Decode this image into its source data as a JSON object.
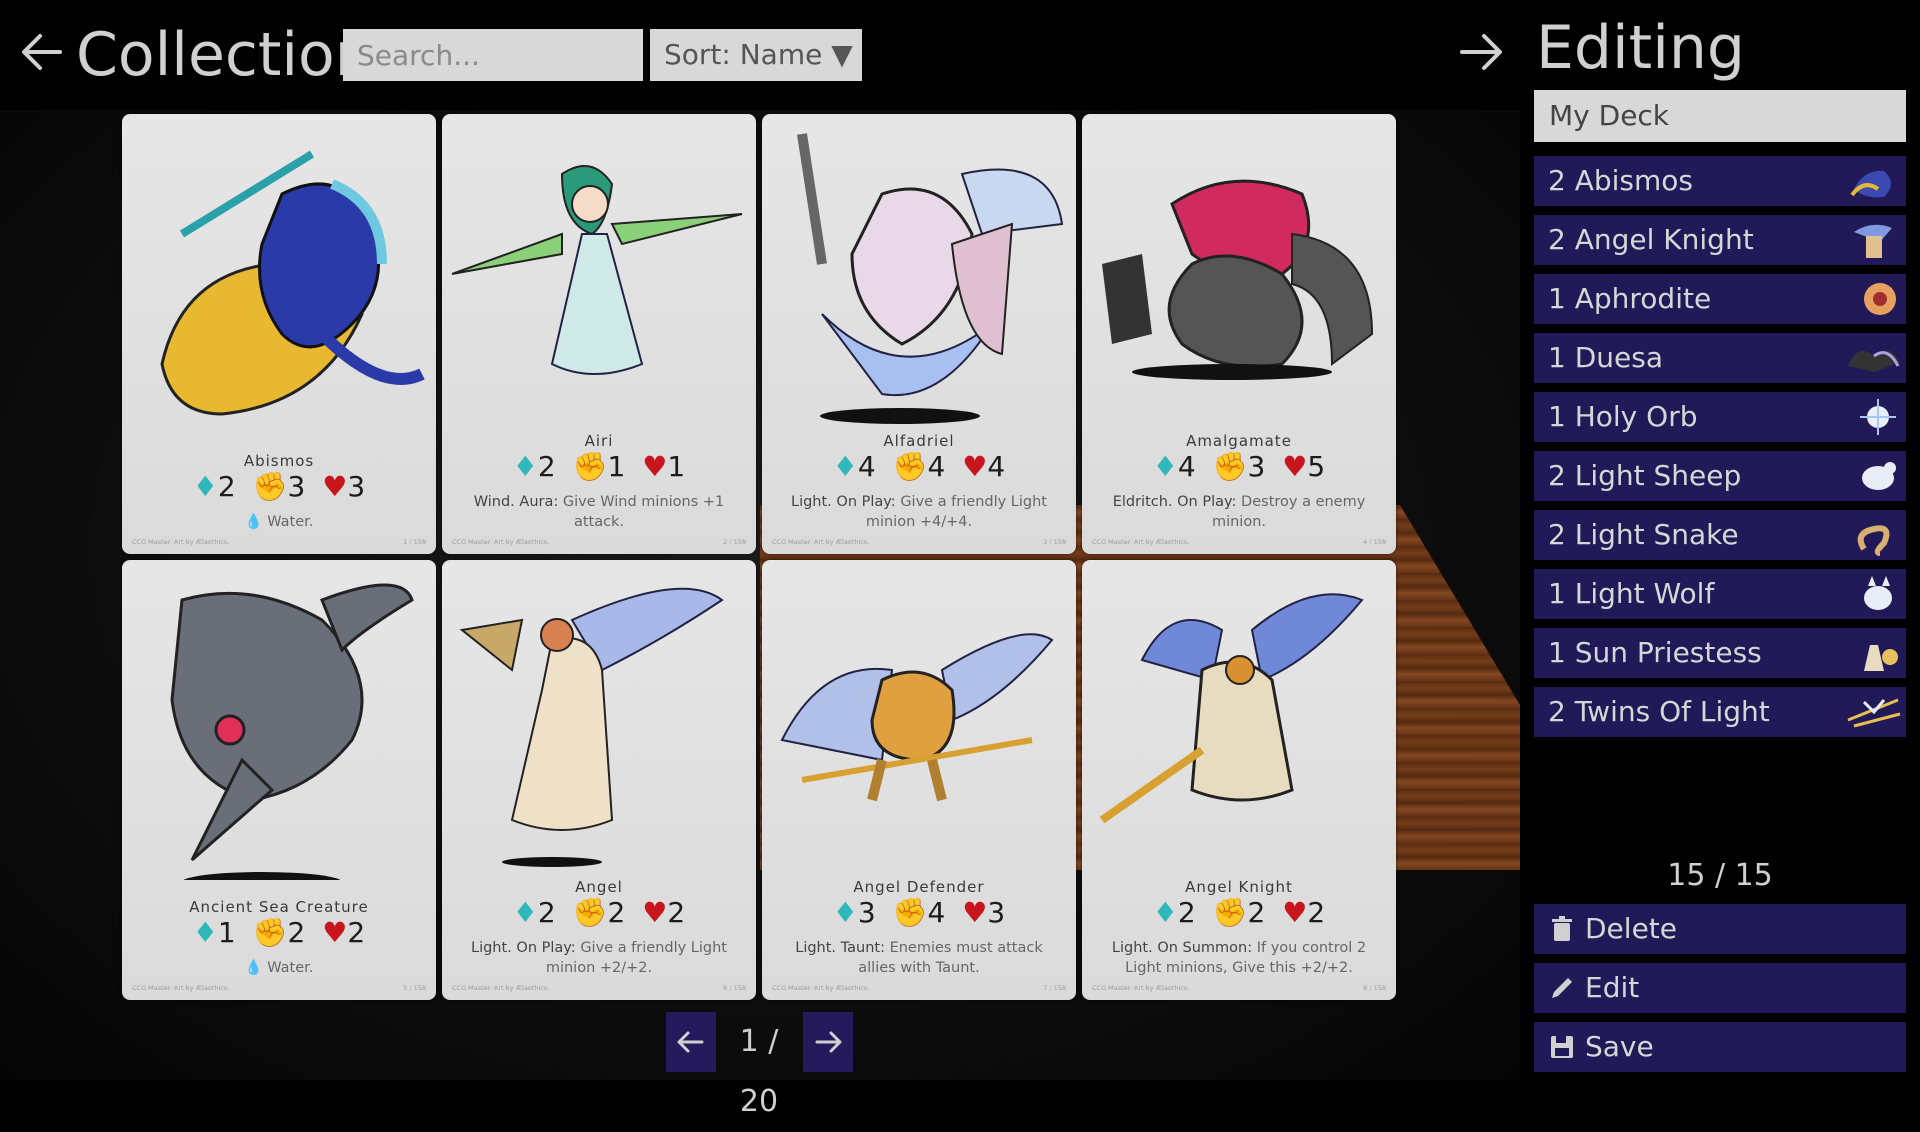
{
  "header": {
    "title": "Collection",
    "search_placeholder": "Search...",
    "search_value": "",
    "sort_label": "Sort: Name ▼"
  },
  "cards": [
    {
      "name": "Abismos",
      "cost": "2",
      "attack": "3",
      "health": "3",
      "tags": "💧 Water.",
      "desc": "",
      "credit": "CCG Master. Art by Ælaothics.",
      "num": "1 / 158"
    },
    {
      "name": "Airi",
      "cost": "2",
      "attack": "1",
      "health": "1",
      "tags": "",
      "desc_type": "Wind.",
      "desc_kw": "Aura:",
      "desc_text": "Give Wind minions +1 attack.",
      "credit": "CCG Master. Art by Ælaothics.",
      "num": "2 / 158"
    },
    {
      "name": "Alfadriel",
      "cost": "4",
      "attack": "4",
      "health": "4",
      "desc_type": "Light.",
      "desc_kw": "On Play:",
      "desc_text": "Give a friendly Light minion +4/+4.",
      "credit": "CCG Master. Art by Ælaothics.",
      "num": "3 / 158"
    },
    {
      "name": "Amalgamate",
      "cost": "4",
      "attack": "3",
      "health": "5",
      "desc_type": "Eldritch.",
      "desc_kw": "On Play:",
      "desc_text": "Destroy a enemy minion.",
      "credit": "CCG Master. Art by Ælaothics.",
      "num": "4 / 158"
    },
    {
      "name": "Ancient Sea Creature",
      "cost": "1",
      "attack": "2",
      "health": "2",
      "tags": "💧 Water.",
      "credit": "CCG Master. Art by Ælaothics.",
      "num": "5 / 158"
    },
    {
      "name": "Angel",
      "cost": "2",
      "attack": "2",
      "health": "2",
      "desc_type": "Light.",
      "desc_kw": "On Play:",
      "desc_text": "Give a friendly Light minion +2/+2.",
      "credit": "CCG Master. Art by Ælaothics.",
      "num": "6 / 158"
    },
    {
      "name": "Angel Defender",
      "cost": "3",
      "attack": "4",
      "health": "3",
      "desc_type": "Light.",
      "desc_kw": "Taunt:",
      "desc_text": "Enemies must attack allies with Taunt.",
      "credit": "CCG Master. Art by Ælaothics.",
      "num": "7 / 158"
    },
    {
      "name": "Angel Knight",
      "cost": "2",
      "attack": "2",
      "health": "2",
      "desc_type": "Light.",
      "desc_kw": "On Summon:",
      "desc_text": "If you control 2 Light minions, Give this +2/+2.",
      "credit": "CCG Master. Art by Ælaothics.",
      "num": "8 / 158"
    }
  ],
  "pager": {
    "text": "1 / 20"
  },
  "panel": {
    "title": "Editing",
    "deck_name": "My Deck",
    "items": [
      {
        "label": "2 Abismos"
      },
      {
        "label": "2 Angel Knight"
      },
      {
        "label": "1 Aphrodite"
      },
      {
        "label": "1 Duesa"
      },
      {
        "label": "1 Holy Orb"
      },
      {
        "label": "2 Light Sheep"
      },
      {
        "label": "2 Light Snake"
      },
      {
        "label": "1 Light Wolf"
      },
      {
        "label": "1 Sun Priestess"
      },
      {
        "label": "2 Twins Of Light"
      }
    ],
    "count": "15 / 15",
    "delete_label": "Delete",
    "edit_label": "Edit",
    "save_label": "Save"
  },
  "colors": {
    "accent": "#221a58",
    "gem": "#2fb8b8",
    "attack": "#d8982c",
    "health": "#c8161c"
  }
}
